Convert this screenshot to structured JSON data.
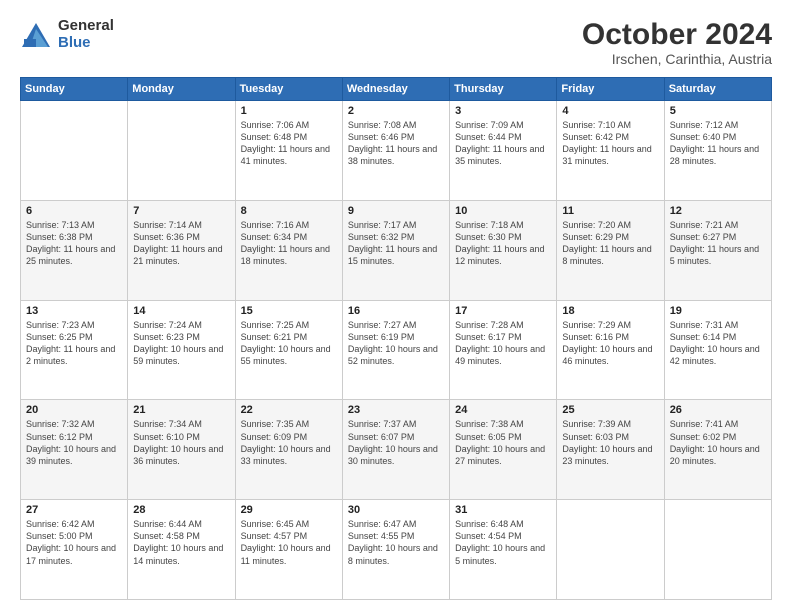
{
  "logo": {
    "general": "General",
    "blue": "Blue"
  },
  "title": "October 2024",
  "subtitle": "Irschen, Carinthia, Austria",
  "days_of_week": [
    "Sunday",
    "Monday",
    "Tuesday",
    "Wednesday",
    "Thursday",
    "Friday",
    "Saturday"
  ],
  "weeks": [
    [
      {
        "day": "",
        "info": ""
      },
      {
        "day": "",
        "info": ""
      },
      {
        "day": "1",
        "info": "Sunrise: 7:06 AM\nSunset: 6:48 PM\nDaylight: 11 hours and 41 minutes."
      },
      {
        "day": "2",
        "info": "Sunrise: 7:08 AM\nSunset: 6:46 PM\nDaylight: 11 hours and 38 minutes."
      },
      {
        "day": "3",
        "info": "Sunrise: 7:09 AM\nSunset: 6:44 PM\nDaylight: 11 hours and 35 minutes."
      },
      {
        "day": "4",
        "info": "Sunrise: 7:10 AM\nSunset: 6:42 PM\nDaylight: 11 hours and 31 minutes."
      },
      {
        "day": "5",
        "info": "Sunrise: 7:12 AM\nSunset: 6:40 PM\nDaylight: 11 hours and 28 minutes."
      }
    ],
    [
      {
        "day": "6",
        "info": "Sunrise: 7:13 AM\nSunset: 6:38 PM\nDaylight: 11 hours and 25 minutes."
      },
      {
        "day": "7",
        "info": "Sunrise: 7:14 AM\nSunset: 6:36 PM\nDaylight: 11 hours and 21 minutes."
      },
      {
        "day": "8",
        "info": "Sunrise: 7:16 AM\nSunset: 6:34 PM\nDaylight: 11 hours and 18 minutes."
      },
      {
        "day": "9",
        "info": "Sunrise: 7:17 AM\nSunset: 6:32 PM\nDaylight: 11 hours and 15 minutes."
      },
      {
        "day": "10",
        "info": "Sunrise: 7:18 AM\nSunset: 6:30 PM\nDaylight: 11 hours and 12 minutes."
      },
      {
        "day": "11",
        "info": "Sunrise: 7:20 AM\nSunset: 6:29 PM\nDaylight: 11 hours and 8 minutes."
      },
      {
        "day": "12",
        "info": "Sunrise: 7:21 AM\nSunset: 6:27 PM\nDaylight: 11 hours and 5 minutes."
      }
    ],
    [
      {
        "day": "13",
        "info": "Sunrise: 7:23 AM\nSunset: 6:25 PM\nDaylight: 11 hours and 2 minutes."
      },
      {
        "day": "14",
        "info": "Sunrise: 7:24 AM\nSunset: 6:23 PM\nDaylight: 10 hours and 59 minutes."
      },
      {
        "day": "15",
        "info": "Sunrise: 7:25 AM\nSunset: 6:21 PM\nDaylight: 10 hours and 55 minutes."
      },
      {
        "day": "16",
        "info": "Sunrise: 7:27 AM\nSunset: 6:19 PM\nDaylight: 10 hours and 52 minutes."
      },
      {
        "day": "17",
        "info": "Sunrise: 7:28 AM\nSunset: 6:17 PM\nDaylight: 10 hours and 49 minutes."
      },
      {
        "day": "18",
        "info": "Sunrise: 7:29 AM\nSunset: 6:16 PM\nDaylight: 10 hours and 46 minutes."
      },
      {
        "day": "19",
        "info": "Sunrise: 7:31 AM\nSunset: 6:14 PM\nDaylight: 10 hours and 42 minutes."
      }
    ],
    [
      {
        "day": "20",
        "info": "Sunrise: 7:32 AM\nSunset: 6:12 PM\nDaylight: 10 hours and 39 minutes."
      },
      {
        "day": "21",
        "info": "Sunrise: 7:34 AM\nSunset: 6:10 PM\nDaylight: 10 hours and 36 minutes."
      },
      {
        "day": "22",
        "info": "Sunrise: 7:35 AM\nSunset: 6:09 PM\nDaylight: 10 hours and 33 minutes."
      },
      {
        "day": "23",
        "info": "Sunrise: 7:37 AM\nSunset: 6:07 PM\nDaylight: 10 hours and 30 minutes."
      },
      {
        "day": "24",
        "info": "Sunrise: 7:38 AM\nSunset: 6:05 PM\nDaylight: 10 hours and 27 minutes."
      },
      {
        "day": "25",
        "info": "Sunrise: 7:39 AM\nSunset: 6:03 PM\nDaylight: 10 hours and 23 minutes."
      },
      {
        "day": "26",
        "info": "Sunrise: 7:41 AM\nSunset: 6:02 PM\nDaylight: 10 hours and 20 minutes."
      }
    ],
    [
      {
        "day": "27",
        "info": "Sunrise: 6:42 AM\nSunset: 5:00 PM\nDaylight: 10 hours and 17 minutes."
      },
      {
        "day": "28",
        "info": "Sunrise: 6:44 AM\nSunset: 4:58 PM\nDaylight: 10 hours and 14 minutes."
      },
      {
        "day": "29",
        "info": "Sunrise: 6:45 AM\nSunset: 4:57 PM\nDaylight: 10 hours and 11 minutes."
      },
      {
        "day": "30",
        "info": "Sunrise: 6:47 AM\nSunset: 4:55 PM\nDaylight: 10 hours and 8 minutes."
      },
      {
        "day": "31",
        "info": "Sunrise: 6:48 AM\nSunset: 4:54 PM\nDaylight: 10 hours and 5 minutes."
      },
      {
        "day": "",
        "info": ""
      },
      {
        "day": "",
        "info": ""
      }
    ]
  ]
}
